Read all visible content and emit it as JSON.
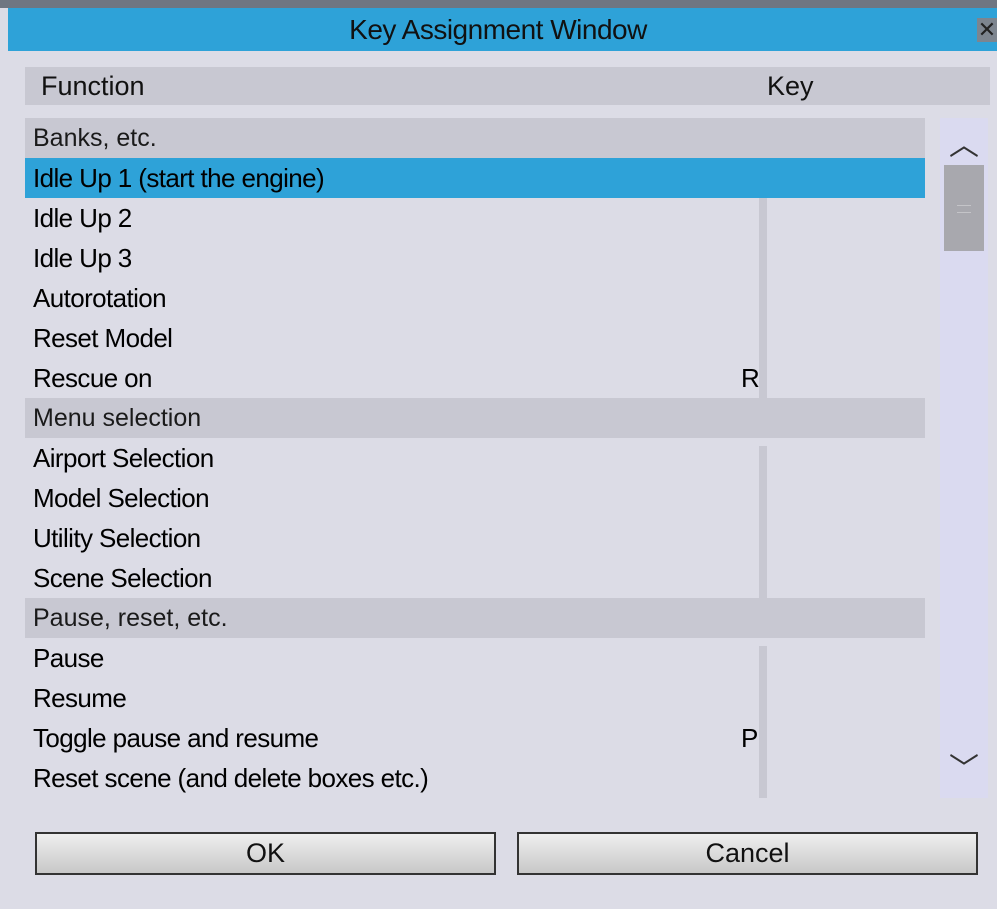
{
  "window": {
    "title": "Key Assignment Window",
    "close_glyph": "✕"
  },
  "columns": {
    "function": "Function",
    "key": "Key"
  },
  "sections": [
    {
      "label": "Banks, etc.",
      "items": [
        {
          "label": "Idle Up 1 (start the engine)",
          "key": "",
          "selected": true
        },
        {
          "label": "Idle Up 2",
          "key": ""
        },
        {
          "label": "Idle Up 3",
          "key": ""
        },
        {
          "label": "Autorotation",
          "key": ""
        },
        {
          "label": "Reset Model",
          "key": ""
        },
        {
          "label": "Rescue on",
          "key": "R"
        }
      ]
    },
    {
      "label": "Menu selection",
      "items": [
        {
          "label": "Airport Selection",
          "key": ""
        },
        {
          "label": "Model Selection",
          "key": ""
        },
        {
          "label": "Utility Selection",
          "key": ""
        },
        {
          "label": "Scene Selection",
          "key": ""
        }
      ]
    },
    {
      "label": "Pause, reset, etc.",
      "items": [
        {
          "label": "Pause",
          "key": ""
        },
        {
          "label": "Resume",
          "key": ""
        },
        {
          "label": "Toggle pause and resume",
          "key": "P"
        },
        {
          "label": "Reset scene (and delete boxes etc.)",
          "key": ""
        }
      ]
    }
  ],
  "scrollbar": {
    "up_glyph": "︿",
    "down_glyph": "﹀"
  },
  "buttons": {
    "ok": "OK",
    "cancel": "Cancel"
  },
  "colors": {
    "title_bar": "#2ea2d8",
    "selection": "#2ea2d8",
    "background": "#dcdce6",
    "section_header": "#c8c8d2"
  }
}
